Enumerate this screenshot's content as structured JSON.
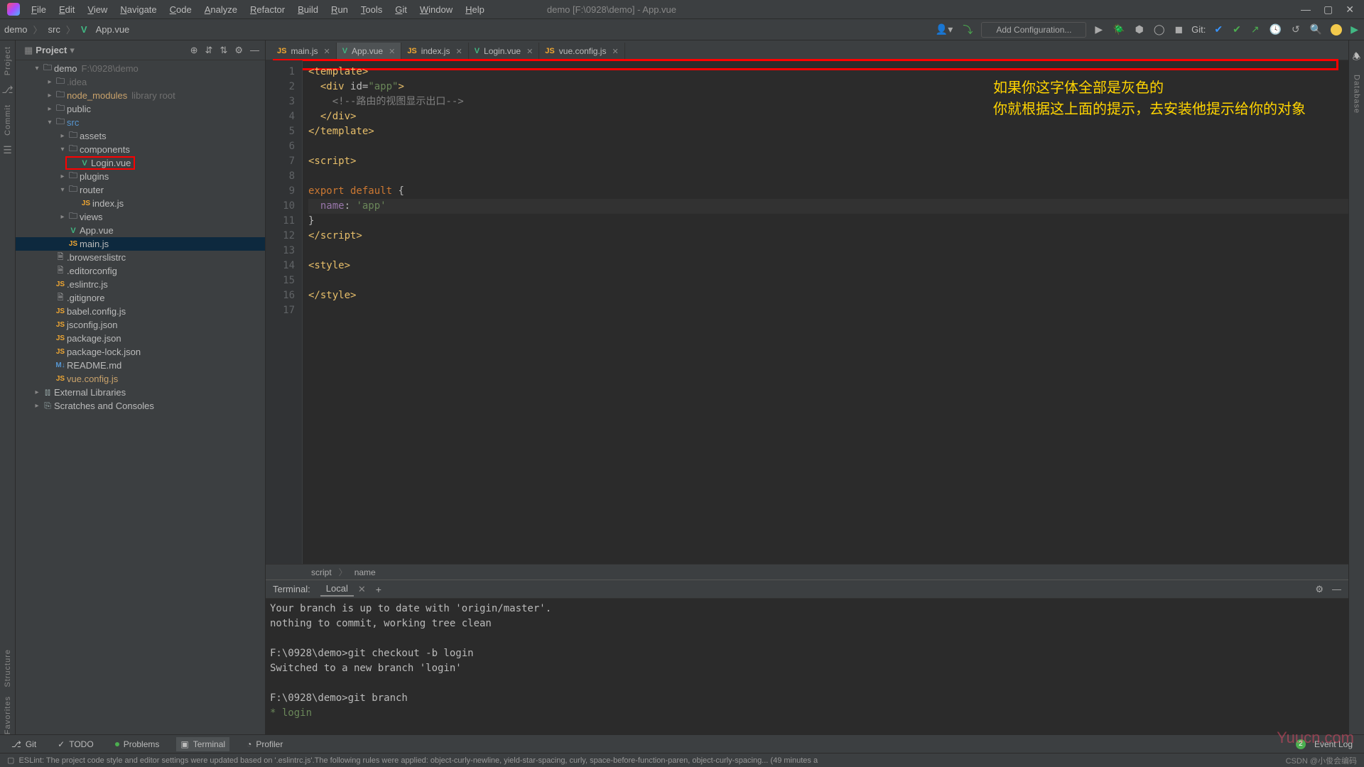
{
  "menubar": [
    "File",
    "Edit",
    "View",
    "Navigate",
    "Code",
    "Analyze",
    "Refactor",
    "Build",
    "Run",
    "Tools",
    "Git",
    "Window",
    "Help"
  ],
  "window_title": "demo [F:\\0928\\demo] - App.vue",
  "breadcrumbs": {
    "parts": [
      "demo",
      "src"
    ],
    "file": "App.vue"
  },
  "toolbar": {
    "add_configuration": "Add Configuration...",
    "git_label": "Git:"
  },
  "project_panel": {
    "title": "Project",
    "tree": [
      {
        "depth": 1,
        "arrow": "▾",
        "icon": "folder",
        "label": "demo",
        "hint": "F:\\0928\\demo",
        "class": ""
      },
      {
        "depth": 2,
        "arrow": "▸",
        "icon": "folder",
        "label": ".idea",
        "class": "dim"
      },
      {
        "depth": 2,
        "arrow": "▸",
        "icon": "folder",
        "label": "node_modules",
        "hint": "library root",
        "class": "orange"
      },
      {
        "depth": 2,
        "arrow": "▸",
        "icon": "folder",
        "label": "public",
        "class": ""
      },
      {
        "depth": 2,
        "arrow": "▾",
        "icon": "folder",
        "label": "src",
        "class": "blue"
      },
      {
        "depth": 3,
        "arrow": "▸",
        "icon": "folder",
        "label": "assets",
        "class": ""
      },
      {
        "depth": 3,
        "arrow": "▾",
        "icon": "folder",
        "label": "components",
        "class": ""
      },
      {
        "depth": 4,
        "arrow": "",
        "icon": "vue",
        "label": "Login.vue",
        "class": "",
        "redbox": true
      },
      {
        "depth": 3,
        "arrow": "▸",
        "icon": "folder",
        "label": "plugins",
        "class": ""
      },
      {
        "depth": 3,
        "arrow": "▾",
        "icon": "folder",
        "label": "router",
        "class": ""
      },
      {
        "depth": 4,
        "arrow": "",
        "icon": "js",
        "label": "index.js",
        "class": ""
      },
      {
        "depth": 3,
        "arrow": "▸",
        "icon": "folder",
        "label": "views",
        "class": ""
      },
      {
        "depth": 3,
        "arrow": "",
        "icon": "vue",
        "label": "App.vue",
        "class": ""
      },
      {
        "depth": 3,
        "arrow": "",
        "icon": "js",
        "label": "main.js",
        "class": "selected"
      },
      {
        "depth": 2,
        "arrow": "",
        "icon": "file",
        "label": ".browserslistrc",
        "class": ""
      },
      {
        "depth": 2,
        "arrow": "",
        "icon": "file",
        "label": ".editorconfig",
        "class": ""
      },
      {
        "depth": 2,
        "arrow": "",
        "icon": "js",
        "label": ".eslintrc.js",
        "class": ""
      },
      {
        "depth": 2,
        "arrow": "",
        "icon": "file",
        "label": ".gitignore",
        "class": ""
      },
      {
        "depth": 2,
        "arrow": "",
        "icon": "js",
        "label": "babel.config.js",
        "class": ""
      },
      {
        "depth": 2,
        "arrow": "",
        "icon": "js",
        "label": "jsconfig.json",
        "class": ""
      },
      {
        "depth": 2,
        "arrow": "",
        "icon": "js",
        "label": "package.json",
        "class": ""
      },
      {
        "depth": 2,
        "arrow": "",
        "icon": "js",
        "label": "package-lock.json",
        "class": ""
      },
      {
        "depth": 2,
        "arrow": "",
        "icon": "md",
        "label": "README.md",
        "class": ""
      },
      {
        "depth": 2,
        "arrow": "",
        "icon": "js",
        "label": "vue.config.js",
        "class": "orange"
      },
      {
        "depth": 1,
        "arrow": "▸",
        "icon": "lib",
        "label": "External Libraries",
        "class": ""
      },
      {
        "depth": 1,
        "arrow": "▸",
        "icon": "scratch",
        "label": "Scratches and Consoles",
        "class": ""
      }
    ]
  },
  "editor_tabs": [
    {
      "icon": "js",
      "label": "main.js",
      "active": false
    },
    {
      "icon": "vue",
      "label": "App.vue",
      "active": true
    },
    {
      "icon": "js",
      "label": "index.js",
      "active": false
    },
    {
      "icon": "vue",
      "label": "Login.vue",
      "active": false
    },
    {
      "icon": "js",
      "label": "vue.config.js",
      "active": false
    }
  ],
  "editor": {
    "lines": [
      {
        "n": 1,
        "html": "<span class='tag'>&lt;template&gt;</span>"
      },
      {
        "n": 2,
        "html": "  <span class='tag'>&lt;div</span> <span class='attr'>id=</span><span class='str'>\"app\"</span><span class='tag'>&gt;</span>"
      },
      {
        "n": 3,
        "html": "    <span class='comm'>&lt;!--路由的视图显示出口--&gt;</span>"
      },
      {
        "n": 4,
        "html": "  <span class='tag'>&lt;/div&gt;</span>"
      },
      {
        "n": 5,
        "html": "<span class='tag'>&lt;/template&gt;</span>"
      },
      {
        "n": 6,
        "html": ""
      },
      {
        "n": 7,
        "html": "<span class='tag'>&lt;script&gt;</span>"
      },
      {
        "n": 8,
        "html": ""
      },
      {
        "n": 9,
        "html": "<span class='kw'>export default</span> <span class='punct'>{</span>"
      },
      {
        "n": 10,
        "html": "  <span class='prop'>name</span><span class='punct'>:</span> <span class='str'>'app'</span>",
        "hl": true
      },
      {
        "n": 11,
        "html": "<span class='punct'>}</span>"
      },
      {
        "n": 12,
        "html": "<span class='tag'>&lt;/script&gt;</span>"
      },
      {
        "n": 13,
        "html": ""
      },
      {
        "n": 14,
        "html": "<span class='tag'>&lt;style&gt;</span>"
      },
      {
        "n": 15,
        "html": ""
      },
      {
        "n": 16,
        "html": "<span class='tag'>&lt;/style&gt;</span>"
      },
      {
        "n": 17,
        "html": ""
      }
    ],
    "annotation_l1": "如果你这字体全部是灰色的",
    "annotation_l2": "你就根据这上面的提示，去安装他提示给你的对象",
    "breadcrumb": [
      "script",
      "name"
    ]
  },
  "terminal": {
    "title": "Terminal:",
    "tabs": [
      "Local"
    ],
    "lines": [
      "Your branch is up to date with 'origin/master'.",
      "nothing to commit, working tree clean",
      "",
      "F:\\0928\\demo>git checkout -b login",
      "Switched to a new branch 'login'",
      "",
      "F:\\0928\\demo>git branch",
      "* login"
    ]
  },
  "bottom_tools": {
    "git": "Git",
    "todo": "TODO",
    "problems": "Problems",
    "terminal": "Terminal",
    "profiler": "Profiler",
    "event_log": "Event Log",
    "badge": "2"
  },
  "statusbar": {
    "left": "ESLint: The project code style and editor settings were updated based on '.eslintrc.js'.The following rules were applied: object-curly-newline, yield-star-spacing, curly, space-before-function-paren, object-curly-spacing... (49 minutes a",
    "right": "CSDN @小俊会编码"
  },
  "watermark": "Yuucn.com"
}
